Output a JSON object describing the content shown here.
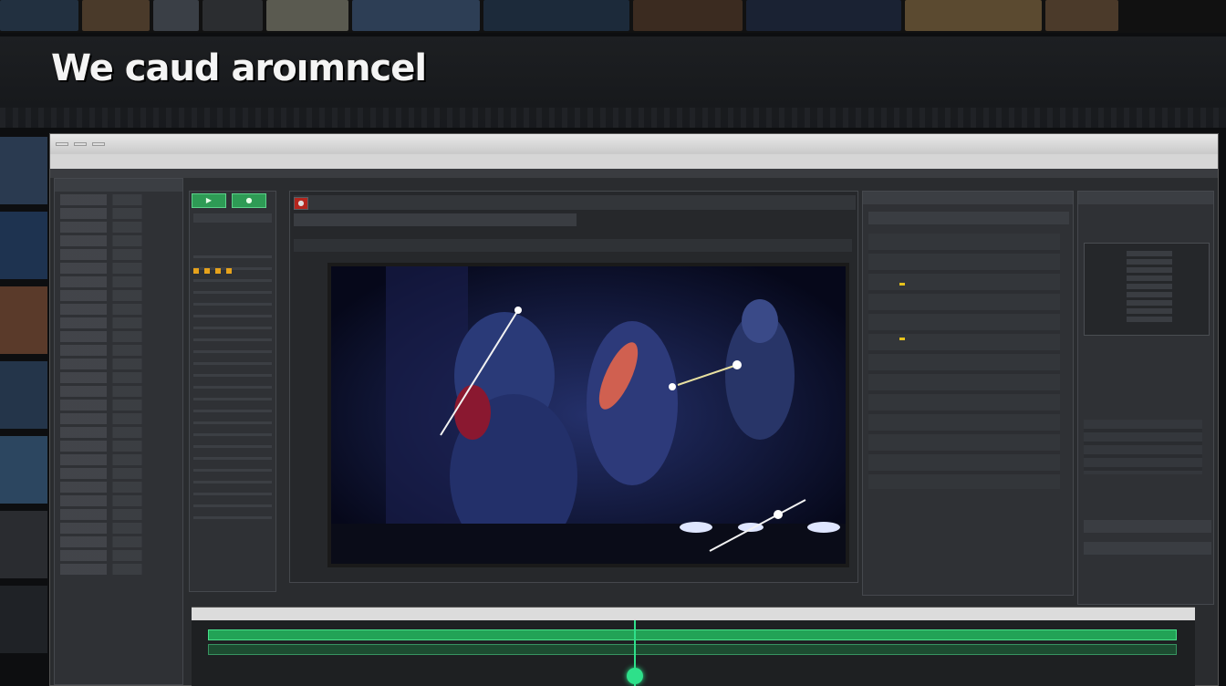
{
  "headline": "We caud aroımncel",
  "colors": {
    "accent_green": "#2e9b55",
    "playhead": "#2ee08a",
    "window_bg": "#2a2c2f"
  },
  "window": {
    "titlebar_tabs": [
      "",
      "",
      ""
    ],
    "titlebar_right": "",
    "menu": [
      "",
      "",
      "",
      "",
      "",
      "",
      "",
      "",
      "",
      "",
      "",
      "",
      ""
    ]
  },
  "left_panel": {
    "header": ""
  },
  "viewer": {
    "transport_label": ""
  },
  "timeline": {
    "header": "",
    "timecode": ""
  },
  "icons": [
    "play-icon",
    "stop-icon",
    "record-icon",
    "close-icon",
    "minimize-icon",
    "maximize-icon"
  ]
}
